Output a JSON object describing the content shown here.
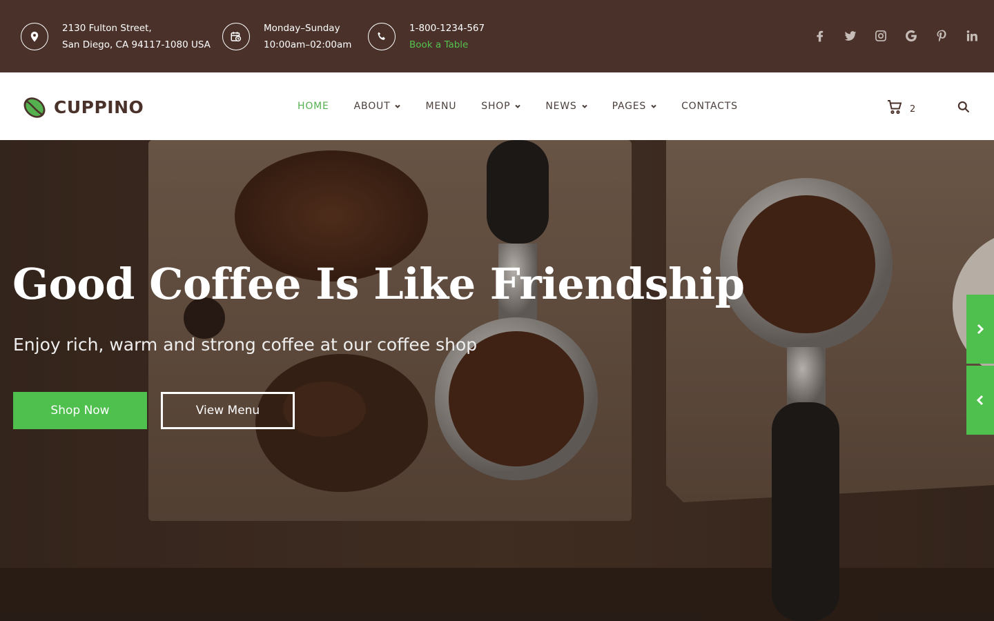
{
  "topbar": {
    "address": {
      "line1": "2130 Fulton Street,",
      "line2": "San Diego, CA 94117-1080 USA",
      "icon": "location-pin-icon"
    },
    "hours": {
      "line1": "Monday–Sunday",
      "line2": "10:00am–02:00am",
      "icon": "calendar-clock-icon"
    },
    "phone": {
      "line1": "1-800-1234-567",
      "line2": "Book a Table",
      "icon": "phone-icon"
    },
    "social": [
      "facebook",
      "twitter",
      "instagram",
      "google",
      "pinterest",
      "linkedin"
    ]
  },
  "navbar": {
    "brand": "CUPPINO",
    "items": [
      {
        "label": "HOME",
        "active": true,
        "dropdown": false
      },
      {
        "label": "ABOUT",
        "active": false,
        "dropdown": true
      },
      {
        "label": "MENU",
        "active": false,
        "dropdown": false
      },
      {
        "label": "SHOP",
        "active": false,
        "dropdown": true
      },
      {
        "label": "NEWS",
        "active": false,
        "dropdown": true
      },
      {
        "label": "PAGES",
        "active": false,
        "dropdown": true
      },
      {
        "label": "CONTACTS",
        "active": false,
        "dropdown": false
      }
    ],
    "cart_count": "2"
  },
  "hero": {
    "title": "Good Coffee Is Like Friendship",
    "subtitle": "Enjoy rich, warm and strong coffee at our coffee shop",
    "primary_button": "Shop Now",
    "secondary_button": "View Menu"
  },
  "colors": {
    "topbar_bg": "#4a322b",
    "accent_green": "#4fbf4d",
    "brand_brown": "#4a322b"
  }
}
